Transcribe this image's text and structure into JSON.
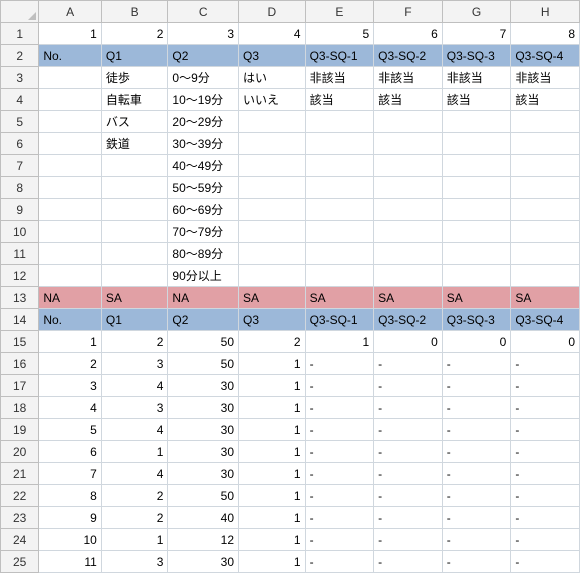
{
  "columns": [
    "A",
    "B",
    "C",
    "D",
    "E",
    "F",
    "G",
    "H"
  ],
  "row_numbers": [
    1,
    2,
    3,
    4,
    5,
    6,
    7,
    8,
    9,
    10,
    11,
    12,
    13,
    14,
    15,
    16,
    17,
    18,
    19,
    20,
    21,
    22,
    23,
    24,
    25
  ],
  "rows": [
    {
      "style": "",
      "cells": [
        {
          "v": "1",
          "align": "num"
        },
        {
          "v": "2",
          "align": "num"
        },
        {
          "v": "3",
          "align": "num"
        },
        {
          "v": "4",
          "align": "num"
        },
        {
          "v": "5",
          "align": "num"
        },
        {
          "v": "6",
          "align": "num"
        },
        {
          "v": "7",
          "align": "num"
        },
        {
          "v": "8",
          "align": "num",
          "clip": true
        }
      ]
    },
    {
      "style": "blue",
      "cells": [
        {
          "v": "No.",
          "align": "txt"
        },
        {
          "v": "Q1",
          "align": "txt"
        },
        {
          "v": "Q2",
          "align": "txt"
        },
        {
          "v": "Q3",
          "align": "txt"
        },
        {
          "v": "Q3-SQ-1",
          "align": "txt"
        },
        {
          "v": "Q3-SQ-2",
          "align": "txt"
        },
        {
          "v": "Q3-SQ-3",
          "align": "txt"
        },
        {
          "v": "Q3-SQ-4",
          "align": "txt"
        }
      ]
    },
    {
      "style": "",
      "cells": [
        {
          "v": "",
          "align": "txt"
        },
        {
          "v": "徒歩",
          "align": "txt"
        },
        {
          "v": "0～9分",
          "align": "txt"
        },
        {
          "v": "はい",
          "align": "txt"
        },
        {
          "v": "非該当",
          "align": "txt"
        },
        {
          "v": "非該当",
          "align": "txt"
        },
        {
          "v": "非該当",
          "align": "txt"
        },
        {
          "v": "非該当",
          "align": "txt"
        }
      ]
    },
    {
      "style": "",
      "cells": [
        {
          "v": "",
          "align": "txt"
        },
        {
          "v": "自転車",
          "align": "txt"
        },
        {
          "v": "10～19分",
          "align": "txt"
        },
        {
          "v": "いいえ",
          "align": "txt"
        },
        {
          "v": "該当",
          "align": "txt"
        },
        {
          "v": "該当",
          "align": "txt"
        },
        {
          "v": "該当",
          "align": "txt"
        },
        {
          "v": "該当",
          "align": "txt"
        }
      ]
    },
    {
      "style": "",
      "cells": [
        {
          "v": "",
          "align": "txt"
        },
        {
          "v": "バス",
          "align": "txt"
        },
        {
          "v": "20～29分",
          "align": "txt"
        },
        {
          "v": "",
          "align": "txt"
        },
        {
          "v": "",
          "align": "txt"
        },
        {
          "v": "",
          "align": "txt"
        },
        {
          "v": "",
          "align": "txt"
        },
        {
          "v": "",
          "align": "txt"
        }
      ]
    },
    {
      "style": "",
      "cells": [
        {
          "v": "",
          "align": "txt"
        },
        {
          "v": "鉄道",
          "align": "txt"
        },
        {
          "v": "30～39分",
          "align": "txt"
        },
        {
          "v": "",
          "align": "txt"
        },
        {
          "v": "",
          "align": "txt"
        },
        {
          "v": "",
          "align": "txt"
        },
        {
          "v": "",
          "align": "txt"
        },
        {
          "v": "",
          "align": "txt"
        }
      ]
    },
    {
      "style": "",
      "cells": [
        {
          "v": "",
          "align": "txt"
        },
        {
          "v": "",
          "align": "txt"
        },
        {
          "v": "40～49分",
          "align": "txt"
        },
        {
          "v": "",
          "align": "txt"
        },
        {
          "v": "",
          "align": "txt"
        },
        {
          "v": "",
          "align": "txt"
        },
        {
          "v": "",
          "align": "txt"
        },
        {
          "v": "",
          "align": "txt"
        }
      ]
    },
    {
      "style": "",
      "cells": [
        {
          "v": "",
          "align": "txt"
        },
        {
          "v": "",
          "align": "txt"
        },
        {
          "v": "50～59分",
          "align": "txt"
        },
        {
          "v": "",
          "align": "txt"
        },
        {
          "v": "",
          "align": "txt"
        },
        {
          "v": "",
          "align": "txt"
        },
        {
          "v": "",
          "align": "txt"
        },
        {
          "v": "",
          "align": "txt"
        }
      ]
    },
    {
      "style": "",
      "cells": [
        {
          "v": "",
          "align": "txt"
        },
        {
          "v": "",
          "align": "txt"
        },
        {
          "v": "60～69分",
          "align": "txt"
        },
        {
          "v": "",
          "align": "txt"
        },
        {
          "v": "",
          "align": "txt"
        },
        {
          "v": "",
          "align": "txt"
        },
        {
          "v": "",
          "align": "txt"
        },
        {
          "v": "",
          "align": "txt"
        }
      ]
    },
    {
      "style": "",
      "cells": [
        {
          "v": "",
          "align": "txt"
        },
        {
          "v": "",
          "align": "txt"
        },
        {
          "v": "70～79分",
          "align": "txt"
        },
        {
          "v": "",
          "align": "txt"
        },
        {
          "v": "",
          "align": "txt"
        },
        {
          "v": "",
          "align": "txt"
        },
        {
          "v": "",
          "align": "txt"
        },
        {
          "v": "",
          "align": "txt"
        }
      ]
    },
    {
      "style": "",
      "cells": [
        {
          "v": "",
          "align": "txt"
        },
        {
          "v": "",
          "align": "txt"
        },
        {
          "v": "80～89分",
          "align": "txt"
        },
        {
          "v": "",
          "align": "txt"
        },
        {
          "v": "",
          "align": "txt"
        },
        {
          "v": "",
          "align": "txt"
        },
        {
          "v": "",
          "align": "txt"
        },
        {
          "v": "",
          "align": "txt"
        }
      ]
    },
    {
      "style": "",
      "cells": [
        {
          "v": "",
          "align": "txt"
        },
        {
          "v": "",
          "align": "txt"
        },
        {
          "v": "90分以上",
          "align": "txt"
        },
        {
          "v": "",
          "align": "txt"
        },
        {
          "v": "",
          "align": "txt"
        },
        {
          "v": "",
          "align": "txt"
        },
        {
          "v": "",
          "align": "txt"
        },
        {
          "v": "",
          "align": "txt"
        }
      ]
    },
    {
      "style": "red",
      "cells": [
        {
          "v": "NA",
          "align": "txt"
        },
        {
          "v": "SA",
          "align": "txt"
        },
        {
          "v": "NA",
          "align": "txt"
        },
        {
          "v": "SA",
          "align": "txt"
        },
        {
          "v": "SA",
          "align": "txt"
        },
        {
          "v": "SA",
          "align": "txt"
        },
        {
          "v": "SA",
          "align": "txt"
        },
        {
          "v": "SA",
          "align": "txt"
        }
      ]
    },
    {
      "style": "blue",
      "cells": [
        {
          "v": "No.",
          "align": "txt"
        },
        {
          "v": "Q1",
          "align": "txt"
        },
        {
          "v": "Q2",
          "align": "txt"
        },
        {
          "v": "Q3",
          "align": "txt"
        },
        {
          "v": "Q3-SQ-1",
          "align": "txt"
        },
        {
          "v": "Q3-SQ-2",
          "align": "txt"
        },
        {
          "v": "Q3-SQ-3",
          "align": "txt"
        },
        {
          "v": "Q3-SQ-4",
          "align": "txt"
        }
      ]
    },
    {
      "style": "",
      "cells": [
        {
          "v": "1",
          "align": "num"
        },
        {
          "v": "2",
          "align": "num"
        },
        {
          "v": "50",
          "align": "num"
        },
        {
          "v": "2",
          "align": "num"
        },
        {
          "v": "1",
          "align": "num"
        },
        {
          "v": "0",
          "align": "num"
        },
        {
          "v": "0",
          "align": "num"
        },
        {
          "v": "0",
          "align": "num",
          "clip": true
        }
      ]
    },
    {
      "style": "",
      "cells": [
        {
          "v": "2",
          "align": "num"
        },
        {
          "v": "3",
          "align": "num"
        },
        {
          "v": "50",
          "align": "num"
        },
        {
          "v": "1",
          "align": "num"
        },
        {
          "v": "-",
          "align": "txt"
        },
        {
          "v": "-",
          "align": "txt"
        },
        {
          "v": "-",
          "align": "txt"
        },
        {
          "v": "-",
          "align": "txt"
        }
      ]
    },
    {
      "style": "",
      "cells": [
        {
          "v": "3",
          "align": "num"
        },
        {
          "v": "4",
          "align": "num"
        },
        {
          "v": "30",
          "align": "num"
        },
        {
          "v": "1",
          "align": "num"
        },
        {
          "v": "-",
          "align": "txt"
        },
        {
          "v": "-",
          "align": "txt"
        },
        {
          "v": "-",
          "align": "txt"
        },
        {
          "v": "-",
          "align": "txt"
        }
      ]
    },
    {
      "style": "",
      "cells": [
        {
          "v": "4",
          "align": "num"
        },
        {
          "v": "3",
          "align": "num"
        },
        {
          "v": "30",
          "align": "num"
        },
        {
          "v": "1",
          "align": "num"
        },
        {
          "v": "-",
          "align": "txt"
        },
        {
          "v": "-",
          "align": "txt"
        },
        {
          "v": "-",
          "align": "txt"
        },
        {
          "v": "-",
          "align": "txt"
        }
      ]
    },
    {
      "style": "",
      "cells": [
        {
          "v": "5",
          "align": "num"
        },
        {
          "v": "4",
          "align": "num"
        },
        {
          "v": "30",
          "align": "num"
        },
        {
          "v": "1",
          "align": "num"
        },
        {
          "v": "-",
          "align": "txt"
        },
        {
          "v": "-",
          "align": "txt"
        },
        {
          "v": "-",
          "align": "txt"
        },
        {
          "v": "-",
          "align": "txt"
        }
      ]
    },
    {
      "style": "",
      "cells": [
        {
          "v": "6",
          "align": "num"
        },
        {
          "v": "1",
          "align": "num"
        },
        {
          "v": "30",
          "align": "num"
        },
        {
          "v": "1",
          "align": "num"
        },
        {
          "v": "-",
          "align": "txt"
        },
        {
          "v": "-",
          "align": "txt"
        },
        {
          "v": "-",
          "align": "txt"
        },
        {
          "v": "-",
          "align": "txt"
        }
      ]
    },
    {
      "style": "",
      "cells": [
        {
          "v": "7",
          "align": "num"
        },
        {
          "v": "4",
          "align": "num"
        },
        {
          "v": "30",
          "align": "num"
        },
        {
          "v": "1",
          "align": "num"
        },
        {
          "v": "-",
          "align": "txt"
        },
        {
          "v": "-",
          "align": "txt"
        },
        {
          "v": "-",
          "align": "txt"
        },
        {
          "v": "-",
          "align": "txt"
        }
      ]
    },
    {
      "style": "",
      "cells": [
        {
          "v": "8",
          "align": "num"
        },
        {
          "v": "2",
          "align": "num"
        },
        {
          "v": "50",
          "align": "num"
        },
        {
          "v": "1",
          "align": "num"
        },
        {
          "v": "-",
          "align": "txt"
        },
        {
          "v": "-",
          "align": "txt"
        },
        {
          "v": "-",
          "align": "txt"
        },
        {
          "v": "-",
          "align": "txt"
        }
      ]
    },
    {
      "style": "",
      "cells": [
        {
          "v": "9",
          "align": "num"
        },
        {
          "v": "2",
          "align": "num"
        },
        {
          "v": "40",
          "align": "num"
        },
        {
          "v": "1",
          "align": "num"
        },
        {
          "v": "-",
          "align": "txt"
        },
        {
          "v": "-",
          "align": "txt"
        },
        {
          "v": "-",
          "align": "txt"
        },
        {
          "v": "-",
          "align": "txt"
        }
      ]
    },
    {
      "style": "",
      "cells": [
        {
          "v": "10",
          "align": "num"
        },
        {
          "v": "1",
          "align": "num"
        },
        {
          "v": "12",
          "align": "num"
        },
        {
          "v": "1",
          "align": "num"
        },
        {
          "v": "-",
          "align": "txt"
        },
        {
          "v": "-",
          "align": "txt"
        },
        {
          "v": "-",
          "align": "txt"
        },
        {
          "v": "-",
          "align": "txt"
        }
      ]
    },
    {
      "style": "",
      "cells": [
        {
          "v": "11",
          "align": "num"
        },
        {
          "v": "3",
          "align": "num"
        },
        {
          "v": "30",
          "align": "num"
        },
        {
          "v": "1",
          "align": "num"
        },
        {
          "v": "-",
          "align": "txt"
        },
        {
          "v": "-",
          "align": "txt"
        },
        {
          "v": "-",
          "align": "txt"
        },
        {
          "v": "-",
          "align": "txt"
        }
      ]
    }
  ]
}
